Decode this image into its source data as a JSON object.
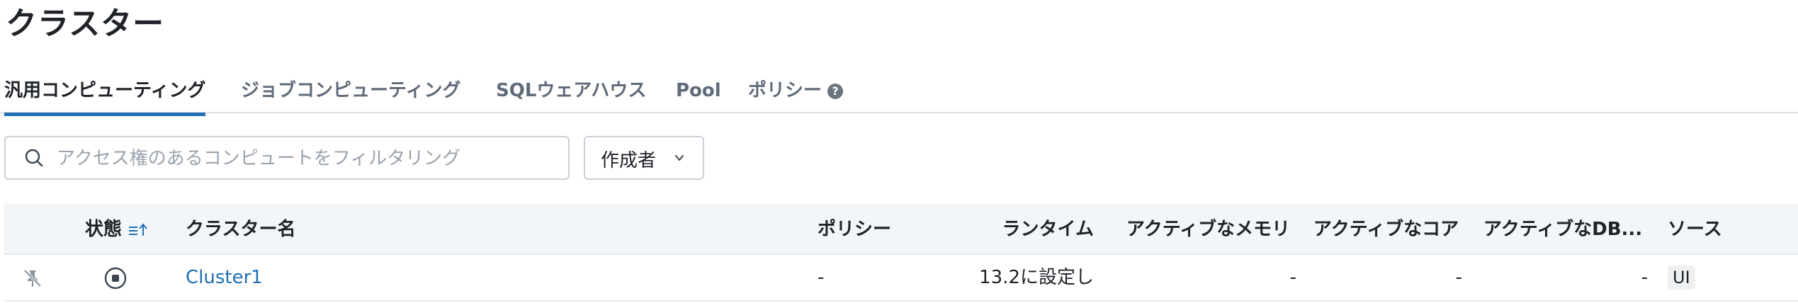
{
  "page": {
    "title": "クラスター"
  },
  "tabs": [
    {
      "label": "汎用コンピューティング",
      "active": true
    },
    {
      "label": "ジョブコンピューティング",
      "active": false
    },
    {
      "label": "SQLウェアハウス",
      "active": false
    },
    {
      "label": "Pool",
      "active": false
    },
    {
      "label": "ポリシー",
      "active": false
    }
  ],
  "filters": {
    "search_placeholder": "アクセス権のあるコンピュートをフィルタリング",
    "search_value": "",
    "creator_label": "作成者"
  },
  "table": {
    "columns": {
      "status": "状態",
      "name": "クラスター名",
      "policy": "ポリシー",
      "runtime": "ランタイム",
      "active_memory": "アクティブなメモリ",
      "active_cores": "アクティブなコア",
      "active_dbu": "アクティブなDB...",
      "source": "ソース"
    },
    "rows": [
      {
        "name": "Cluster1",
        "policy": "-",
        "runtime": "13.2に設定し",
        "active_memory": "-",
        "active_cores": "-",
        "active_dbu": "-",
        "source": "UI"
      }
    ]
  },
  "icons": {
    "search": "search-icon",
    "dropdown": "chevron-down-icon",
    "help": "help-circle-icon",
    "sort": "sort-ascending-icon",
    "pin": "unpinned-icon",
    "status": "stopped-status-icon"
  },
  "colors": {
    "accent": "#1f6fb2",
    "header_bg": "#f3f6f9"
  }
}
